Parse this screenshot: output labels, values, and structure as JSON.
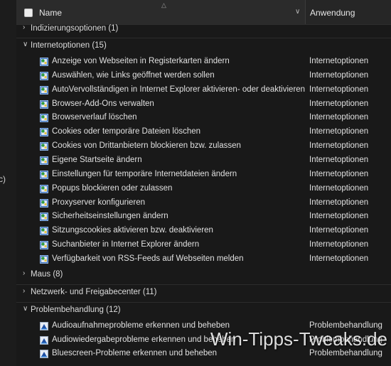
{
  "header": {
    "name_label": "Name",
    "app_label": "Anwendung"
  },
  "left_fragment": "c)",
  "groups": [
    {
      "label": "Indizierungsoptionen (1)",
      "expanded": false
    },
    {
      "label": "Internetoptionen (15)",
      "expanded": true
    },
    {
      "label": "Maus (8)",
      "expanded": false
    },
    {
      "label": "Netzwerk- und Freigabecenter (11)",
      "expanded": false
    },
    {
      "label": "Problembehandlung (12)",
      "expanded": true
    }
  ],
  "internet_items": [
    {
      "label": "Anzeige von Webseiten in Registerkarten ändern",
      "app": "Internetoptionen"
    },
    {
      "label": "Auswählen, wie Links geöffnet werden sollen",
      "app": "Internetoptionen"
    },
    {
      "label": "AutoVervollständigen in Internet Explorer aktivieren- oder deaktivieren",
      "app": "Internetoptionen"
    },
    {
      "label": "Browser-Add-Ons verwalten",
      "app": "Internetoptionen"
    },
    {
      "label": "Browserverlauf löschen",
      "app": "Internetoptionen"
    },
    {
      "label": "Cookies oder temporäre Dateien löschen",
      "app": "Internetoptionen"
    },
    {
      "label": "Cookies von Drittanbietern blockieren bzw. zulassen",
      "app": "Internetoptionen"
    },
    {
      "label": "Eigene Startseite ändern",
      "app": "Internetoptionen"
    },
    {
      "label": "Einstellungen für temporäre Internetdateien ändern",
      "app": "Internetoptionen"
    },
    {
      "label": "Popups blockieren oder zulassen",
      "app": "Internetoptionen"
    },
    {
      "label": "Proxyserver konfigurieren",
      "app": "Internetoptionen"
    },
    {
      "label": "Sicherheitseinstellungen ändern",
      "app": "Internetoptionen"
    },
    {
      "label": "Sitzungscookies aktivieren bzw. deaktivieren",
      "app": "Internetoptionen"
    },
    {
      "label": "Suchanbieter in Internet Explorer ändern",
      "app": "Internetoptionen"
    },
    {
      "label": "Verfügbarkeit von RSS-Feeds auf Webseiten melden",
      "app": "Internetoptionen"
    }
  ],
  "trouble_items": [
    {
      "label": "Audioaufnahmeprobleme erkennen und beheben",
      "app": "Problembehandlung"
    },
    {
      "label": "Audiowiedergabeprobleme erkennen und beheben",
      "app": "Problembehandlung"
    },
    {
      "label": "Bluescreen-Probleme erkennen und beheben",
      "app": "Problembehandlung"
    }
  ],
  "watermark": "Win-Tipps-Tweaks.de",
  "colors": {
    "background": "#191919",
    "header": "#2b2b2b",
    "text": "#e0e0e0",
    "icon_green": "#2e9b3f",
    "icon_blue": "#2f7fd8"
  },
  "icons": {
    "internet_item": "internet-options-icon",
    "trouble_item": "troubleshooting-icon"
  }
}
